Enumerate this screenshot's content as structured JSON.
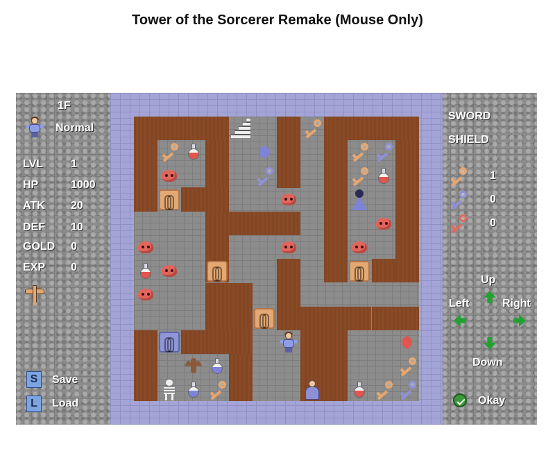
{
  "title": "Tower of the Sorcerer Remake (Mouse Only)",
  "left_panel": {
    "floor": "1F",
    "difficulty": "Normal",
    "stats": [
      {
        "label": "LVL",
        "value": "1"
      },
      {
        "label": "HP",
        "value": "1000"
      },
      {
        "label": "ATK",
        "value": "20"
      },
      {
        "label": "DEF",
        "value": "10"
      },
      {
        "label": "GOLD",
        "value": "0"
      },
      {
        "label": "EXP",
        "value": "0"
      }
    ],
    "save_key": "S",
    "save_label": "Save",
    "load_key": "L",
    "load_label": "Load"
  },
  "right_panel": {
    "sword": "SWORD",
    "shield": "SHIELD",
    "keys": [
      {
        "color": "yellow",
        "count": "1"
      },
      {
        "color": "blue",
        "count": "0"
      },
      {
        "color": "red",
        "count": "0"
      }
    ],
    "dpad": {
      "up": "Up",
      "left": "Left",
      "right": "Right",
      "down": "Down"
    },
    "okay": "Okay"
  },
  "colors": {
    "wall": "#8a4a26",
    "border": "#a4a5d6",
    "yellow_key": "#e8a66f",
    "blue_key": "#8f90d8",
    "red_key": "#e06a62",
    "arrow": "#24a033"
  },
  "map": {
    "cols": 12,
    "rows": 12,
    "items": [
      {
        "type": "stairs",
        "col": 4,
        "row": 0
      },
      {
        "type": "yellow-key",
        "col": 7,
        "row": 0
      },
      {
        "type": "yellow-key",
        "col": 1,
        "row": 1
      },
      {
        "type": "red-potion",
        "col": 2,
        "row": 1
      },
      {
        "type": "blue-gem",
        "col": 5,
        "row": 1
      },
      {
        "type": "yellow-key",
        "col": 9,
        "row": 1
      },
      {
        "type": "blue-key",
        "col": 10,
        "row": 1
      },
      {
        "type": "red-slime",
        "col": 1,
        "row": 2
      },
      {
        "type": "blue-key",
        "col": 5,
        "row": 2
      },
      {
        "type": "yellow-key",
        "col": 9,
        "row": 2
      },
      {
        "type": "red-potion",
        "col": 10,
        "row": 2
      },
      {
        "type": "yellow-door",
        "col": 1,
        "row": 3
      },
      {
        "type": "red-slime",
        "col": 6,
        "row": 3
      },
      {
        "type": "wizard",
        "col": 9,
        "row": 3
      },
      {
        "type": "red-slime",
        "col": 10,
        "row": 4
      },
      {
        "type": "red-slime",
        "col": 0,
        "row": 5
      },
      {
        "type": "red-slime",
        "col": 6,
        "row": 5
      },
      {
        "type": "red-slime",
        "col": 9,
        "row": 5
      },
      {
        "type": "red-potion",
        "col": 0,
        "row": 6
      },
      {
        "type": "red-slime",
        "col": 1,
        "row": 6
      },
      {
        "type": "yellow-door",
        "col": 3,
        "row": 6
      },
      {
        "type": "yellow-door",
        "col": 9,
        "row": 6
      },
      {
        "type": "red-slime",
        "col": 0,
        "row": 7
      },
      {
        "type": "yellow-door",
        "col": 5,
        "row": 8
      },
      {
        "type": "blue-door",
        "col": 1,
        "row": 9
      },
      {
        "type": "hero",
        "col": 6,
        "row": 9
      },
      {
        "type": "red-gem",
        "col": 11,
        "row": 9
      },
      {
        "type": "bat",
        "col": 2,
        "row": 10
      },
      {
        "type": "blue-potion",
        "col": 3,
        "row": 10
      },
      {
        "type": "yellow-key",
        "col": 11,
        "row": 10
      },
      {
        "type": "skeleton",
        "col": 1,
        "row": 11
      },
      {
        "type": "blue-potion",
        "col": 2,
        "row": 11
      },
      {
        "type": "yellow-key",
        "col": 3,
        "row": 11
      },
      {
        "type": "sage",
        "col": 7,
        "row": 11
      },
      {
        "type": "red-potion",
        "col": 9,
        "row": 11
      },
      {
        "type": "yellow-key",
        "col": 10,
        "row": 11
      },
      {
        "type": "blue-key",
        "col": 11,
        "row": 11
      }
    ]
  }
}
